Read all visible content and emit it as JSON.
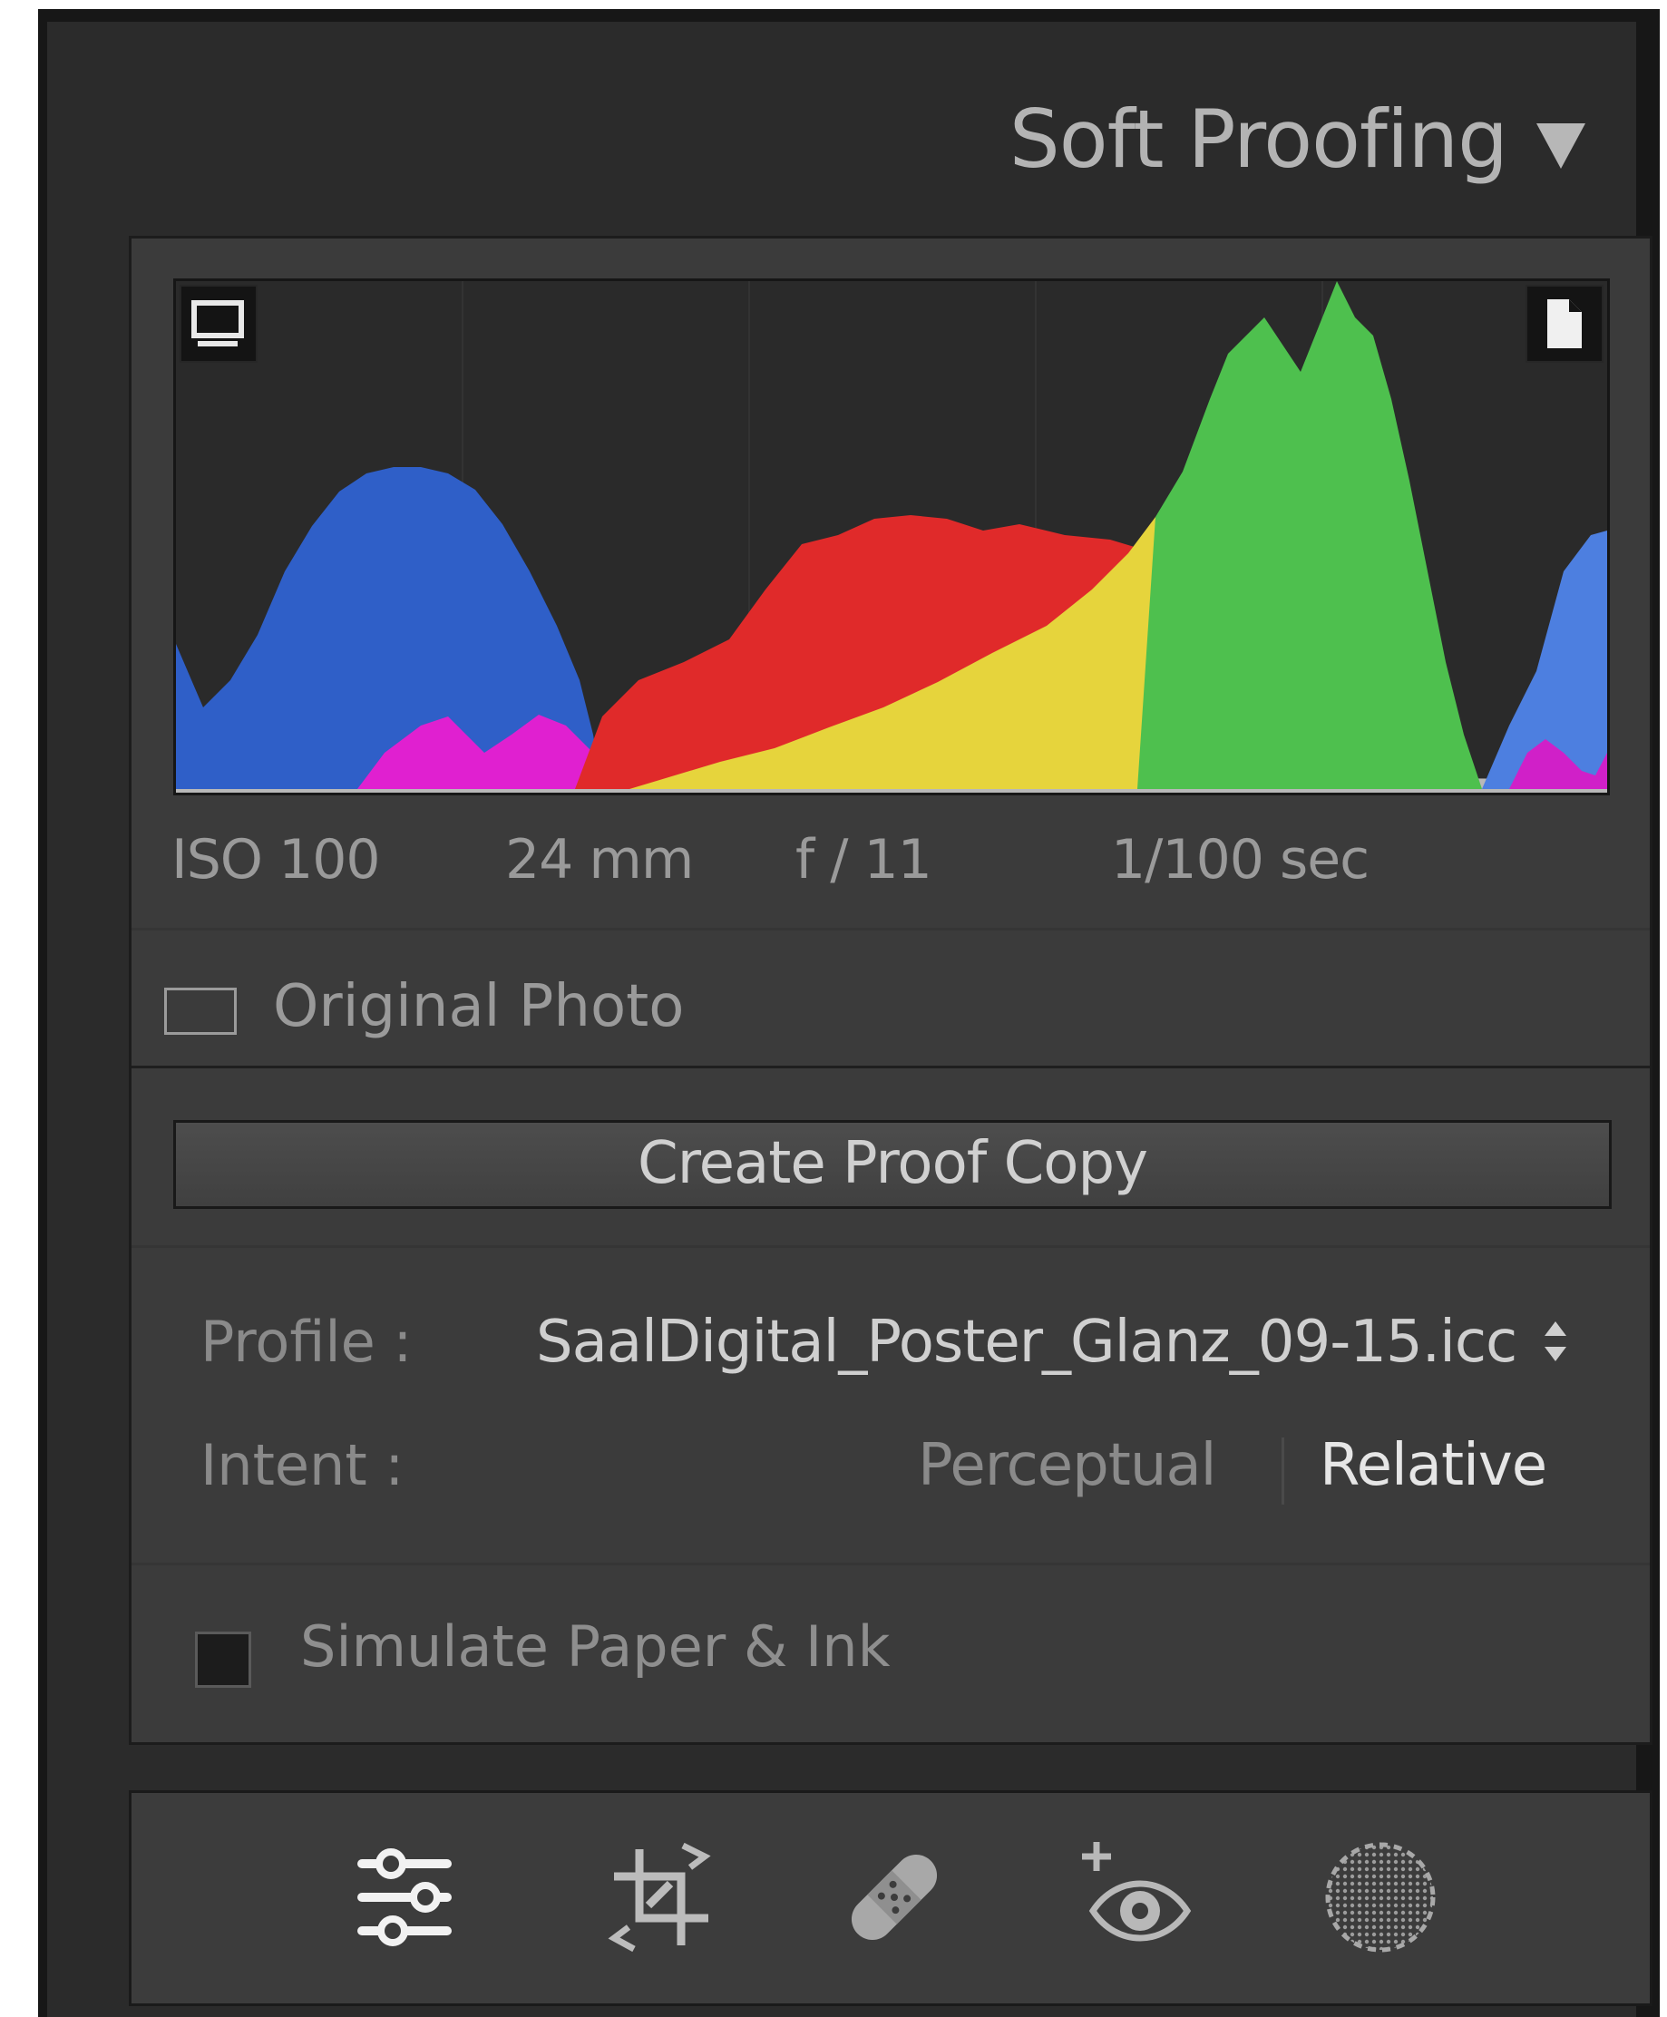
{
  "panel": {
    "title": "Soft Proofing",
    "collapse_icon": "triangle-down-icon"
  },
  "histogram": {
    "monitor_icon": "monitor-icon",
    "paper_icon": "document-icon",
    "colors": {
      "blue": "#2f5fc8",
      "red": "#e02a2a",
      "yellow": "#e6d43c",
      "green": "#4ec04e",
      "magenta": "#e020d0",
      "gray": "#b8b8b8"
    }
  },
  "exif": {
    "iso": "ISO 100",
    "focal": "24 mm",
    "aperture": "f / 11",
    "shutter": "1/100 sec"
  },
  "original_photo": {
    "label": "Original Photo",
    "checked": false
  },
  "proof_button": {
    "label": "Create Proof Copy"
  },
  "profile": {
    "label": "Profile :",
    "value": "SaalDigital_Poster_Glanz_09-15.icc"
  },
  "intent": {
    "label": "Intent :",
    "options": [
      "Perceptual",
      "Relative"
    ],
    "selected": "Relative"
  },
  "simulate": {
    "label": "Simulate Paper & Ink",
    "checked": false
  },
  "toolbar": {
    "tools": [
      "sliders-icon",
      "crop-icon",
      "bandage-icon",
      "redeye-icon",
      "mask-circle-icon"
    ]
  }
}
